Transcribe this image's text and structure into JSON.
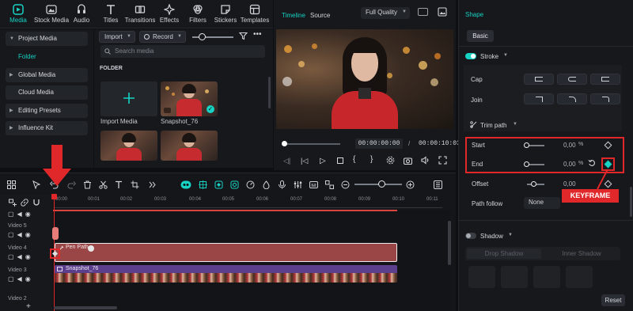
{
  "toolbar": {
    "items": [
      {
        "label": "Media",
        "icon": "media-icon"
      },
      {
        "label": "Stock Media",
        "icon": "stock-media-icon"
      },
      {
        "label": "Audio",
        "icon": "audio-icon"
      },
      {
        "label": "Titles",
        "icon": "titles-icon"
      },
      {
        "label": "Transitions",
        "icon": "transitions-icon"
      },
      {
        "label": "Effects",
        "icon": "effects-icon"
      },
      {
        "label": "Filters",
        "icon": "filters-icon"
      },
      {
        "label": "Stickers",
        "icon": "stickers-icon"
      },
      {
        "label": "Templates",
        "icon": "templates-icon"
      }
    ]
  },
  "media_nav": {
    "items": [
      "Project Media",
      "Folder",
      "Global Media",
      "Cloud Media",
      "Editing Presets",
      "Influence Kit"
    ]
  },
  "media": {
    "import_label": "Import",
    "record_label": "Record",
    "search_placeholder": "Search media",
    "folder_heading": "FOLDER",
    "items": [
      "Import Media",
      "Snapshot_76"
    ]
  },
  "preview": {
    "tab_timeline": "Timeline",
    "tab_source": "Source",
    "quality": "Full Quality",
    "current_time": "00:00:00:00",
    "separator": "/",
    "total_time": "00:00:10:03"
  },
  "inspector": {
    "title": "Shape",
    "tab_basic": "Basic",
    "stroke_label": "Stroke",
    "cap_label": "Cap",
    "join_label": "Join",
    "trim_path_label": "Trim path",
    "start_label": "Start",
    "start_value": "0,00",
    "end_label": "End",
    "end_value": "0,00",
    "offset_label": "Offset",
    "offset_value": "0,00",
    "percent": "%",
    "path_follow_label": "Path follow",
    "path_follow_value": "None",
    "shadow_label": "Shadow",
    "drop_shadow": "Drop Shadow",
    "inner_shadow": "Inner Shadow",
    "reset_label": "Reset",
    "keyframe_callout": "KEYFRAME",
    "accent": "#18d2c4",
    "highlight": "#e0282a"
  },
  "timeline": {
    "ticks": [
      "00:00",
      "00:01",
      "00:02",
      "00:03",
      "00:04",
      "00:05",
      "00:06",
      "00:07",
      "00:08",
      "00:09",
      "00:10",
      "00:11"
    ],
    "tracks": [
      "Video 5",
      "Video 4",
      "Video 3",
      "Video 2"
    ],
    "clip_pen_path": "Pen Path",
    "clip_snapshot": "Snapshot_76"
  }
}
